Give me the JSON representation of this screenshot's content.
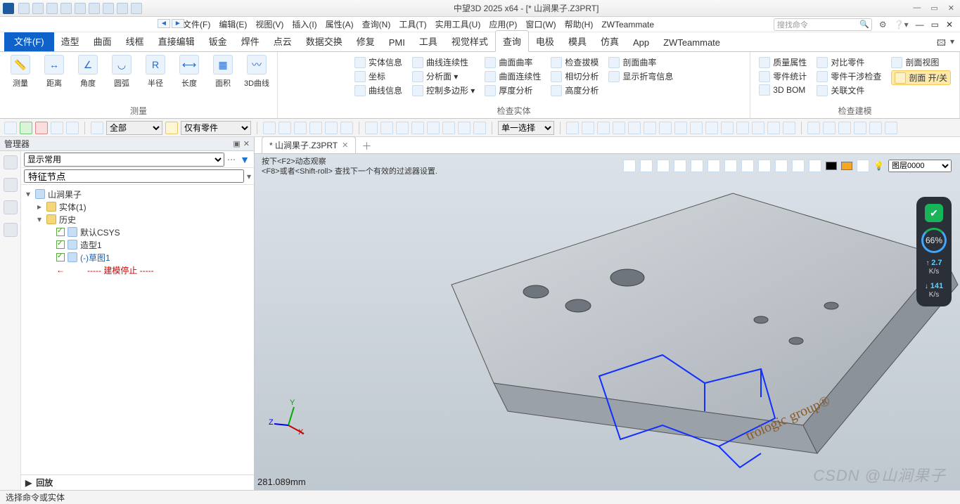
{
  "title": "中望3D 2025 x64 - [* 山涧果子.Z3PRT]",
  "menubar": [
    "文件(F)",
    "编辑(E)",
    "视图(V)",
    "插入(I)",
    "属性(A)",
    "查询(N)",
    "工具(T)",
    "实用工具(U)",
    "应用(P)",
    "窗口(W)",
    "帮助(H)",
    "ZWTeammate"
  ],
  "search_placeholder": "搜找命令",
  "ribbon_tabs": [
    "文件(F)",
    "造型",
    "曲面",
    "线框",
    "直接编辑",
    "钣金",
    "焊件",
    "点云",
    "数据交换",
    "修复",
    "PMI",
    "工具",
    "视觉样式",
    "查询",
    "电极",
    "模具",
    "仿真",
    "App",
    "ZWTeammate"
  ],
  "ribbon_active": "查询",
  "rgroup1": {
    "label": "测量",
    "items": [
      "测量",
      "距离",
      "角度",
      "圆弧",
      "半径",
      "长度",
      "面积",
      "3D曲线"
    ]
  },
  "rgroup2": {
    "label": "检查实体",
    "cols": [
      [
        "实体信息",
        "坐标",
        "曲线信息"
      ],
      [
        "曲线连续性",
        "分析面 ▾",
        "控制多边形 ▾"
      ],
      [
        "曲面曲率",
        "曲面连续性",
        "厚度分析"
      ],
      [
        "检查拔模",
        "相切分析",
        "高度分析"
      ],
      [
        "剖面曲率",
        "显示折弯信息"
      ]
    ]
  },
  "rgroup3": {
    "label": "检查建模",
    "cols": [
      [
        "质量属性",
        "零件统计",
        "3D BOM"
      ],
      [
        "对比零件",
        "零件干涉检查",
        "关联文件"
      ],
      [
        "剖面视图",
        "剖面 开/关"
      ]
    ]
  },
  "toolbar2": {
    "sel1": "全部",
    "sel2": "仅有零件",
    "sel3": "单一选择"
  },
  "left": {
    "title": "管理器",
    "display": "显示常用",
    "feature_header": "特征节点",
    "root": "山涧果子",
    "solid": "实体(1)",
    "history": "历史",
    "csys": "默认CSYS",
    "shape": "造型1",
    "sketch": "(-)草图1",
    "stop": "----- 建模停止 -----",
    "playback": "回放"
  },
  "doc_tab": "* 山涧果子.Z3PRT",
  "hint1": "按下<F2>动态观察",
  "hint2": "<F8>或者<Shift-roll> 查找下一个有效的过滤器设置.",
  "layer": "图层0000",
  "coord": "281.089mm",
  "brand": "trologic group®",
  "watermark": "CSDN @山涧果子",
  "gauge": {
    "pct": "66%",
    "up": "2.7",
    "up_u": "K/s",
    "dn": "141",
    "dn_u": "K/s"
  },
  "status": "选择命令或实体"
}
